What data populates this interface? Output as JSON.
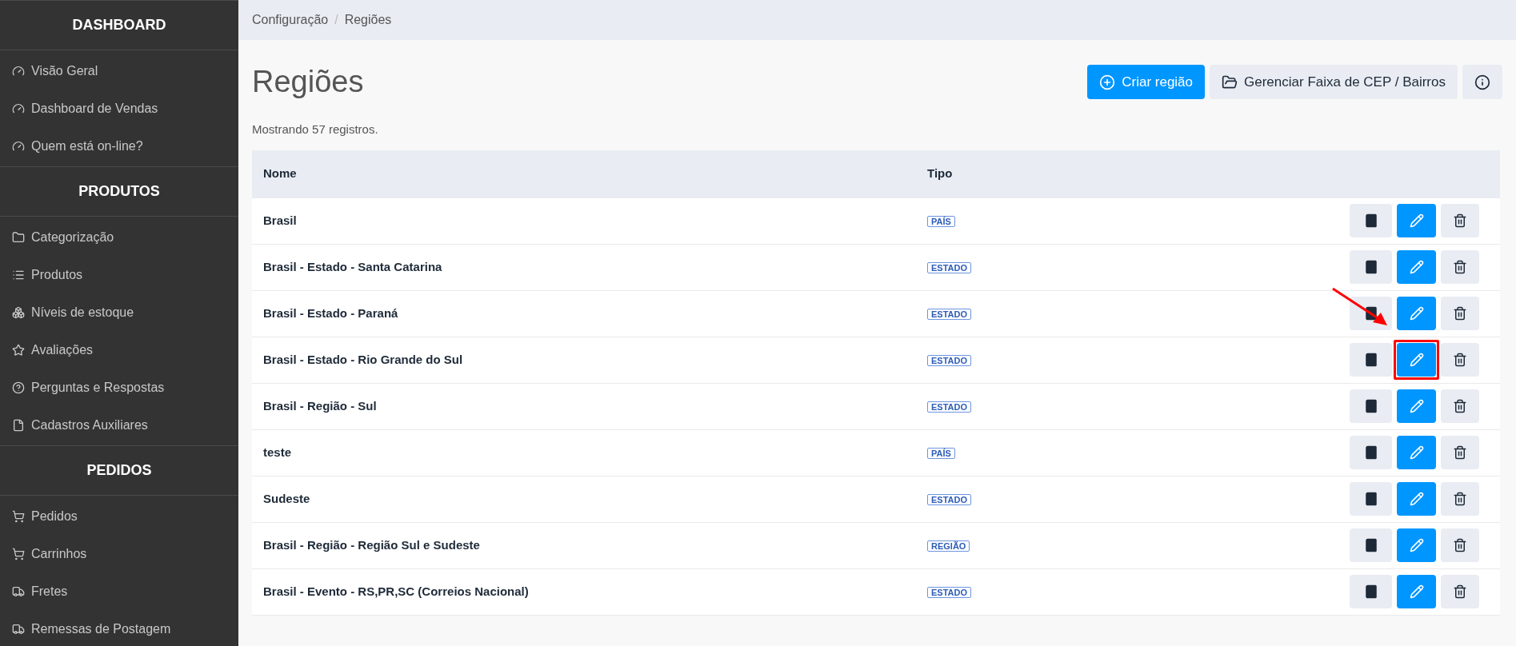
{
  "sidebar": {
    "sections": [
      {
        "title": "DASHBOARD",
        "items": [
          {
            "label": "Visão Geral",
            "kind": "gauge"
          },
          {
            "label": "Dashboard de Vendas",
            "kind": "gauge"
          },
          {
            "label": "Quem está on-line?",
            "kind": "gauge"
          }
        ]
      },
      {
        "title": "PRODUTOS",
        "items": [
          {
            "label": "Categorização",
            "kind": "folder"
          },
          {
            "label": "Produtos",
            "kind": "list"
          },
          {
            "label": "Níveis de estoque",
            "kind": "cubes"
          },
          {
            "label": "Avaliações",
            "kind": "star"
          },
          {
            "label": "Perguntas e Respostas",
            "kind": "help"
          },
          {
            "label": "Cadastros Auxiliares",
            "kind": "file"
          }
        ]
      },
      {
        "title": "PEDIDOS",
        "items": [
          {
            "label": "Pedidos",
            "kind": "cart"
          },
          {
            "label": "Carrinhos",
            "kind": "cart"
          },
          {
            "label": "Fretes",
            "kind": "truck"
          },
          {
            "label": "Remessas de Postagem",
            "kind": "truck"
          }
        ]
      }
    ]
  },
  "breadcrumb": {
    "items": [
      "Configuração",
      "Regiões"
    ],
    "separator": "/"
  },
  "page_title": "Regiões",
  "actions": [
    {
      "kind": "create",
      "label": "Criar região"
    },
    {
      "kind": "manage",
      "label": "Gerenciar Faixa de CEP / Bairros"
    },
    {
      "kind": "info"
    }
  ],
  "summary": "Mostrando 57 registros.",
  "table": {
    "columns": [
      "Nome",
      "Tipo"
    ],
    "rows": [
      {
        "name": "Brasil",
        "type": "PAÍS",
        "highlighted": false
      },
      {
        "name": "Brasil - Estado - Santa Catarina",
        "type": "ESTADO",
        "highlighted": false
      },
      {
        "name": "Brasil - Estado - Paraná",
        "type": "ESTADO",
        "highlighted": false
      },
      {
        "name": "Brasil - Estado - Rio Grande do Sul",
        "type": "ESTADO",
        "highlighted": true
      },
      {
        "name": "Brasil - Região - Sul",
        "type": "ESTADO",
        "highlighted": false
      },
      {
        "name": "teste",
        "type": "PAÍS",
        "highlighted": false
      },
      {
        "name": "Sudeste",
        "type": "ESTADO",
        "highlighted": false
      },
      {
        "name": "Brasil - Região - Região Sul e Sudeste",
        "type": "REGIÃO",
        "highlighted": false
      },
      {
        "name": "Brasil - Evento - RS,PR,SC (Correios Nacional)",
        "type": "ESTADO",
        "highlighted": false
      }
    ]
  }
}
